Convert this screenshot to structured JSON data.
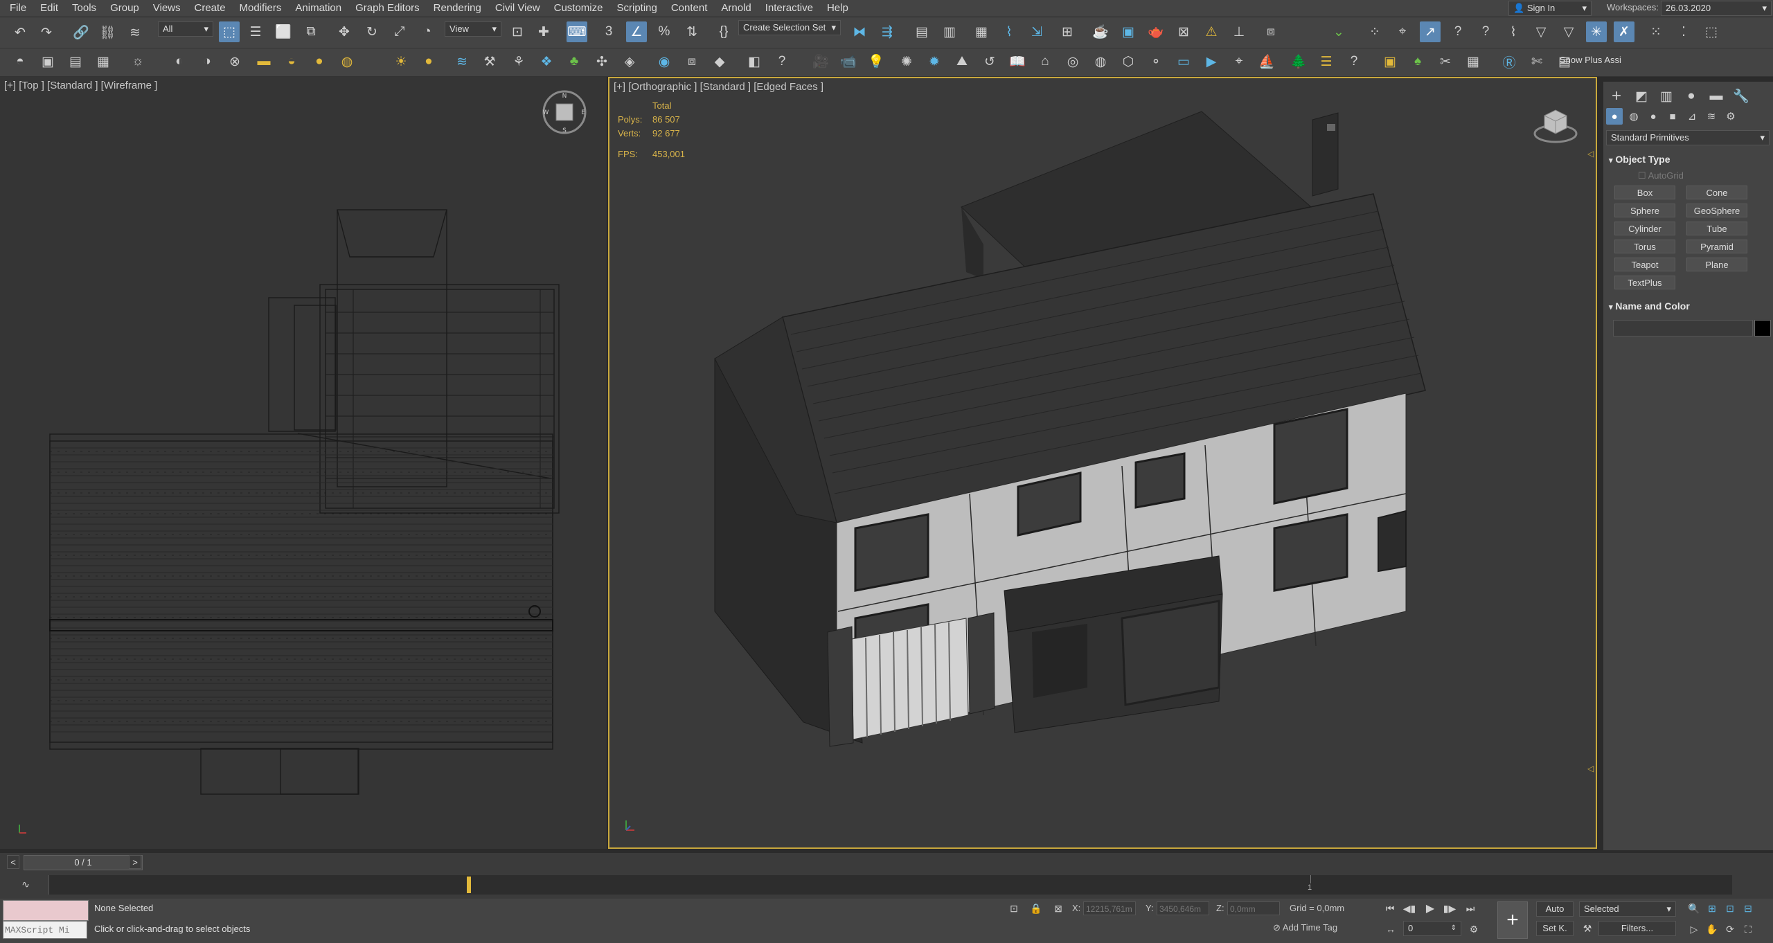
{
  "menu": [
    "File",
    "Edit",
    "Tools",
    "Group",
    "Views",
    "Create",
    "Modifiers",
    "Animation",
    "Graph Editors",
    "Rendering",
    "Civil View",
    "Customize",
    "Scripting",
    "Content",
    "Arnold",
    "Interactive",
    "Help"
  ],
  "signin": {
    "label": "Sign In"
  },
  "workspaces": {
    "label": "Workspaces:",
    "value": "26.03.2020"
  },
  "toolbar": {
    "filter_value": "All",
    "ref_coord_value": "View",
    "selection_set_value": "Create Selection Set",
    "snow_plus_label": "Snow Plus Assi"
  },
  "viewport_left": {
    "label": "[+] [Top ] [Standard ] [Wireframe ]"
  },
  "viewport_right": {
    "label": "[+] [Orthographic ] [Standard ] [Edged Faces ]",
    "stats": {
      "total_label": "Total",
      "polys_label": "Polys:",
      "polys_value": "86 507",
      "verts_label": "Verts:",
      "verts_value": "92 677",
      "fps_label": "FPS:",
      "fps_value": "453,001"
    }
  },
  "command_panel": {
    "category_value": "Standard Primitives",
    "object_type_title": "Object Type",
    "autogrid_label": "AutoGrid",
    "buttons": [
      "Box",
      "Cone",
      "Sphere",
      "GeoSphere",
      "Cylinder",
      "Tube",
      "Torus",
      "Pyramid",
      "Teapot",
      "Plane",
      "TextPlus"
    ],
    "name_color_title": "Name and Color",
    "swatch_color": "#000000"
  },
  "timeline": {
    "frame_label": "0 / 1",
    "tick_1": "1"
  },
  "status": {
    "maxscript_placeholder": "MAXScript Mi",
    "selection_status": "None Selected",
    "prompt": "Click or click-and-drag to select objects",
    "x_label": "X:",
    "x_value": "12215,761m",
    "y_label": "Y:",
    "y_value": "3450,646m",
    "z_label": "Z:",
    "z_value": "0,0mm",
    "grid_label": "Grid = 0,0mm",
    "add_time_tag": "Add Time Tag",
    "auto_label": "Auto",
    "selected_value": "Selected",
    "setk_label": "Set K.",
    "filters_label": "Filters...",
    "frame_value": "0"
  },
  "colors": {
    "accent": "#5b87b3",
    "active_viewport_border": "#c9a83c",
    "stats": "#d9b44a"
  }
}
